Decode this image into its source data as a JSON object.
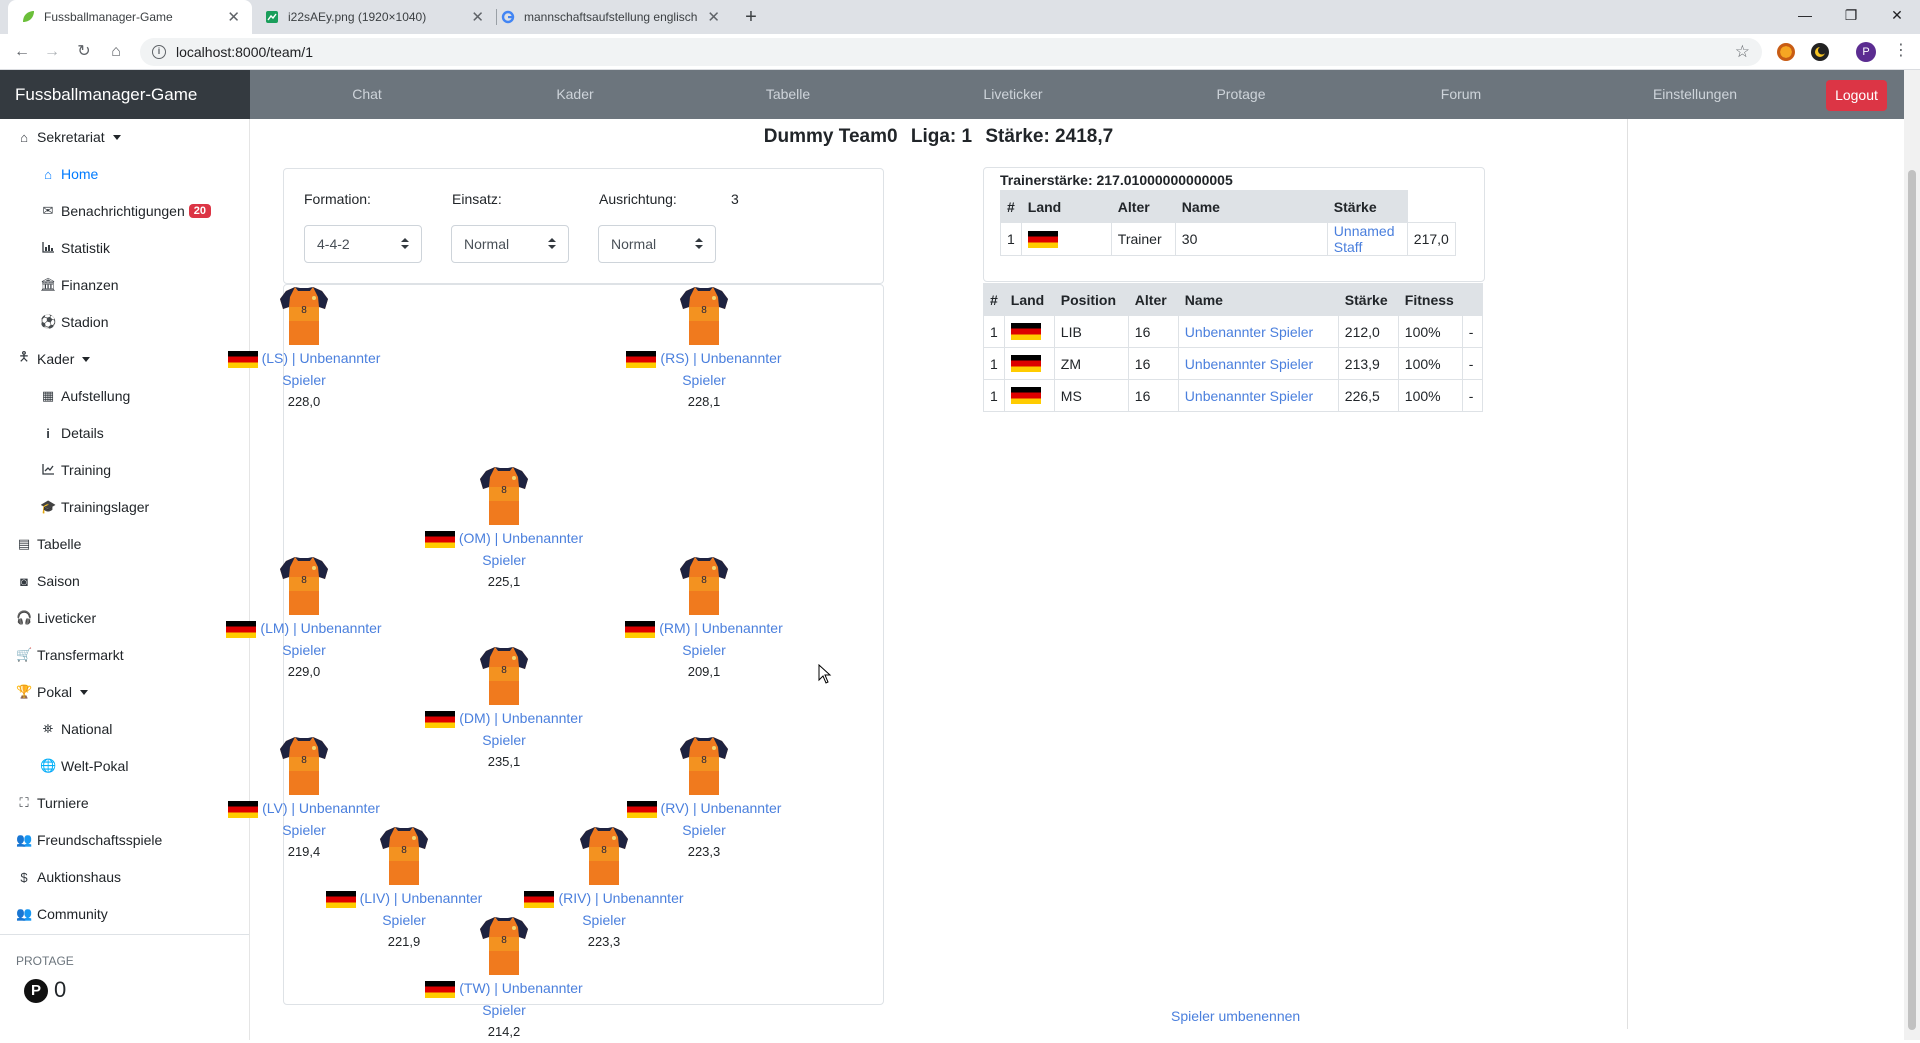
{
  "browser": {
    "tabs": [
      {
        "title": "Fussballmanager-Game",
        "active": true
      },
      {
        "title": "i22sAEy.png (1920×1040)",
        "active": false
      },
      {
        "title": "mannschaftsaufstellung englisch",
        "active": false
      }
    ],
    "url": "localhost:8000/team/1",
    "profile_initial": "P"
  },
  "navbar": {
    "brand": "Fussballmanager-Game",
    "links": [
      "Chat",
      "Kader",
      "Tabelle",
      "Liveticker",
      "Protage",
      "Forum",
      "Einstellungen"
    ],
    "logout": "Logout"
  },
  "sidebar": {
    "items": [
      {
        "label": "Sekretariat",
        "icon": "home-icon",
        "caret": true
      },
      {
        "label": "Home",
        "icon": "home-icon",
        "sub": true,
        "active": true
      },
      {
        "label": "Benachrichtigungen",
        "icon": "envelope-icon",
        "sub": true,
        "badge": "20"
      },
      {
        "label": "Statistik",
        "icon": "chart-icon",
        "sub": true
      },
      {
        "label": "Finanzen",
        "icon": "bank-icon",
        "sub": true
      },
      {
        "label": "Stadion",
        "icon": "ball-icon",
        "sub": true
      },
      {
        "label": "Kader",
        "icon": "person-icon",
        "caret": true
      },
      {
        "label": "Aufstellung",
        "icon": "grid-icon",
        "sub": true
      },
      {
        "label": "Details",
        "icon": "info-icon",
        "sub": true
      },
      {
        "label": "Training",
        "icon": "line-chart-icon",
        "sub": true
      },
      {
        "label": "Trainingslager",
        "icon": "graduation-cap-icon",
        "sub": true
      },
      {
        "label": "Tabelle",
        "icon": "table-icon"
      },
      {
        "label": "Saison",
        "icon": "mask-icon"
      },
      {
        "label": "Liveticker",
        "icon": "headphones-icon"
      },
      {
        "label": "Transfermarkt",
        "icon": "cart-icon"
      },
      {
        "label": "Pokal",
        "icon": "trophy-icon",
        "caret": true
      },
      {
        "label": "National",
        "icon": "map-icon",
        "sub": true
      },
      {
        "label": "Welt-Pokal",
        "icon": "globe-icon",
        "sub": true
      },
      {
        "label": "Turniere",
        "icon": "sitemap-icon"
      },
      {
        "label": "Freundschaftsspiele",
        "icon": "users-icon"
      },
      {
        "label": "Auktionshaus",
        "icon": "dollar-icon"
      },
      {
        "label": "Community",
        "icon": "users-icon"
      }
    ],
    "protage_heading": "PROTAGE",
    "protage_value": "0"
  },
  "team": {
    "name": "Dummy Team0",
    "liga": "Liga: 1",
    "staerke": "Stärke: 2418,7"
  },
  "formation": {
    "formation_label": "Formation:",
    "formation_value": "4-4-2",
    "einsatz_label": "Einsatz:",
    "einsatz_value": "Normal",
    "ausrichtung_label": "Ausrichtung:",
    "ausrichtung_number": "3",
    "ausrichtung_value": "Normal"
  },
  "players": [
    {
      "pos": "(LS) | Unbenannter",
      "name": "Spieler",
      "strength": "228,0"
    },
    {
      "pos": "(RS) | Unbenannter",
      "name": "Spieler",
      "strength": "228,1"
    },
    {
      "pos": "(OM) | Unbenannter",
      "name": "Spieler",
      "strength": "225,1"
    },
    {
      "pos": "(LM) | Unbenannter",
      "name": "Spieler",
      "strength": "229,0"
    },
    {
      "pos": "(RM) | Unbenannter",
      "name": "Spieler",
      "strength": "209,1"
    },
    {
      "pos": "(DM) | Unbenannter",
      "name": "Spieler",
      "strength": "235,1"
    },
    {
      "pos": "(LV) | Unbenannter",
      "name": "Spieler",
      "strength": "219,4"
    },
    {
      "pos": "(RV) | Unbenannter",
      "name": "Spieler",
      "strength": "223,3"
    },
    {
      "pos": "(LIV) | Unbenannter",
      "name": "Spieler",
      "strength": "221,9"
    },
    {
      "pos": "(RIV) | Unbenannter",
      "name": "Spieler",
      "strength": "223,3"
    },
    {
      "pos": "(TW) | Unbenannter",
      "name": "Spieler",
      "strength": "214,2"
    }
  ],
  "jersey_number": "8",
  "trainer": {
    "title": "Trainerstärke: 217.01000000000005",
    "headers": [
      "#",
      "Land",
      "Alter",
      "Name",
      "Stärke"
    ],
    "row": {
      "num": "1",
      "role": "Trainer",
      "age": "30",
      "name": "Unnamed Staff",
      "strength": "217,0"
    }
  },
  "squad": {
    "headers": [
      "#",
      "Land",
      "Position",
      "Alter",
      "Name",
      "Stärke",
      "Fitness",
      ""
    ],
    "rows": [
      {
        "num": "1",
        "position": "LIB",
        "age": "16",
        "name": "Unbenannter Spieler",
        "strength": "212,0",
        "fitness": "100%",
        "extra": "-"
      },
      {
        "num": "1",
        "position": "ZM",
        "age": "16",
        "name": "Unbenannter Spieler",
        "strength": "213,9",
        "fitness": "100%",
        "extra": "-"
      },
      {
        "num": "1",
        "position": "MS",
        "age": "16",
        "name": "Unbenannter Spieler",
        "strength": "226,5",
        "fitness": "100%",
        "extra": "-"
      }
    ]
  },
  "rename_link": "Spieler umbenennen",
  "colors": {
    "navbar": "#6c757d",
    "brand_bg": "#343a40",
    "logout": "#dc3545",
    "link": "#4a7fdd",
    "jersey": "#f07a1e",
    "jersey_sleeve": "#1f2340"
  }
}
